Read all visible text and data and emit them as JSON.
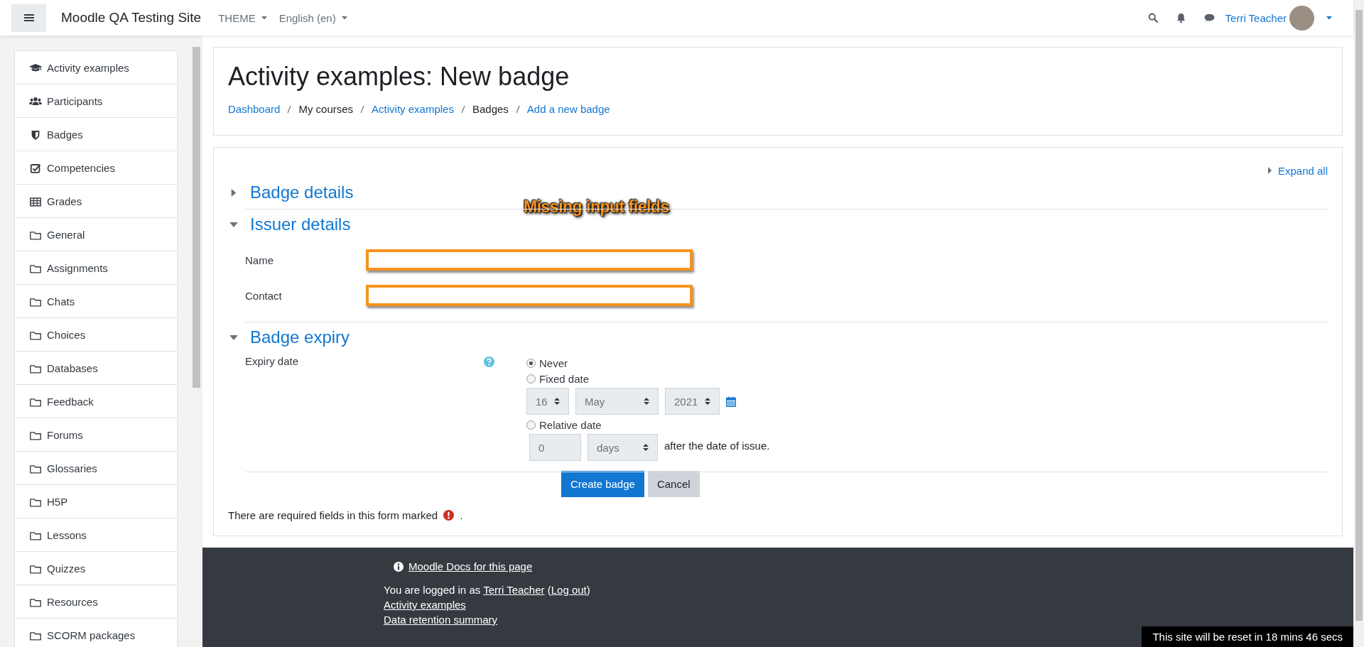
{
  "navbar": {
    "site_name": "Moodle QA Testing Site",
    "menus": [
      "THEME",
      "English (en)"
    ],
    "user_name": "Terri Teacher"
  },
  "nav_drawer": {
    "items": [
      {
        "label": "Activity examples",
        "kind": "course"
      },
      {
        "label": "Participants",
        "kind": "participants"
      },
      {
        "label": "Badges",
        "kind": "badges"
      },
      {
        "label": "Competencies",
        "kind": "competencies"
      },
      {
        "label": "Grades",
        "kind": "grades"
      },
      {
        "label": "General",
        "kind": "section"
      },
      {
        "label": "Assignments",
        "kind": "section"
      },
      {
        "label": "Chats",
        "kind": "section"
      },
      {
        "label": "Choices",
        "kind": "section"
      },
      {
        "label": "Databases",
        "kind": "section"
      },
      {
        "label": "Feedback",
        "kind": "section"
      },
      {
        "label": "Forums",
        "kind": "section"
      },
      {
        "label": "Glossaries",
        "kind": "section"
      },
      {
        "label": "H5P",
        "kind": "section"
      },
      {
        "label": "Lessons",
        "kind": "section"
      },
      {
        "label": "Quizzes",
        "kind": "section"
      },
      {
        "label": "Resources",
        "kind": "section"
      },
      {
        "label": "SCORM packages",
        "kind": "section"
      }
    ]
  },
  "header": {
    "title": "Activity examples: New badge",
    "breadcrumb": [
      {
        "label": "Dashboard",
        "link": true
      },
      {
        "label": "My courses",
        "link": false
      },
      {
        "label": "Activity examples",
        "link": true
      },
      {
        "label": "Badges",
        "link": false
      },
      {
        "label": "Add a new badge",
        "link": true
      }
    ]
  },
  "form": {
    "expand_all": "Expand all",
    "annotation": "Missing input fields",
    "sections": [
      {
        "title": "Badge details",
        "expanded": false
      },
      {
        "kind": "fields",
        "title": "Issuer details",
        "expanded": true,
        "fields": [
          {
            "label": "Name",
            "highlighted": true
          },
          {
            "label": "Contact",
            "highlighted": true
          }
        ]
      },
      {
        "kind": "expiry",
        "title": "Badge expiry",
        "expanded": true,
        "expiry": {
          "label": "Expiry date",
          "options": [
            {
              "kind": "plain",
              "label": "Never",
              "selected": true
            },
            {
              "kind": "date",
              "label": "Fixed date",
              "selected": false,
              "disabled": true,
              "day": "16",
              "month": "May",
              "year": "2021"
            },
            {
              "kind": "relative",
              "label": "Relative date",
              "selected": false,
              "disabled": true,
              "number": "0",
              "unit": "days",
              "suffix": "after the date of issue."
            }
          ]
        }
      }
    ],
    "buttons": [
      {
        "label": "Create badge",
        "kind": "primary"
      },
      {
        "label": "Cancel",
        "kind": "secondary"
      }
    ],
    "required_note": {
      "text": "There are required fields in this form marked",
      "end": "."
    }
  },
  "footer": {
    "docs_link": "Moodle Docs for this page",
    "login": {
      "prefix": "You are logged in as ",
      "user": "Terri Teacher",
      "middle": " (",
      "logout": "Log out",
      "suffix": ")"
    },
    "links": [
      "Activity examples",
      "Data retention summary"
    ]
  },
  "reset_banner": "This site will be reset in 18 mins 46 secs"
}
